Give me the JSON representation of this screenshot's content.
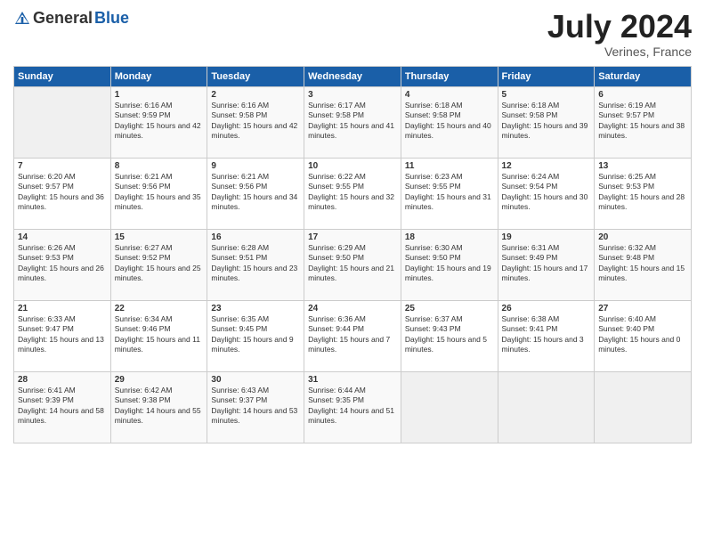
{
  "logo": {
    "general": "General",
    "blue": "Blue"
  },
  "title": "July 2024",
  "location": "Verines, France",
  "days": [
    "Sunday",
    "Monday",
    "Tuesday",
    "Wednesday",
    "Thursday",
    "Friday",
    "Saturday"
  ],
  "weeks": [
    [
      {
        "day": "",
        "empty": true
      },
      {
        "day": "1",
        "sunrise": "Sunrise: 6:16 AM",
        "sunset": "Sunset: 9:59 PM",
        "daylight": "Daylight: 15 hours and 42 minutes."
      },
      {
        "day": "2",
        "sunrise": "Sunrise: 6:16 AM",
        "sunset": "Sunset: 9:58 PM",
        "daylight": "Daylight: 15 hours and 42 minutes."
      },
      {
        "day": "3",
        "sunrise": "Sunrise: 6:17 AM",
        "sunset": "Sunset: 9:58 PM",
        "daylight": "Daylight: 15 hours and 41 minutes."
      },
      {
        "day": "4",
        "sunrise": "Sunrise: 6:18 AM",
        "sunset": "Sunset: 9:58 PM",
        "daylight": "Daylight: 15 hours and 40 minutes."
      },
      {
        "day": "5",
        "sunrise": "Sunrise: 6:18 AM",
        "sunset": "Sunset: 9:58 PM",
        "daylight": "Daylight: 15 hours and 39 minutes."
      },
      {
        "day": "6",
        "sunrise": "Sunrise: 6:19 AM",
        "sunset": "Sunset: 9:57 PM",
        "daylight": "Daylight: 15 hours and 38 minutes."
      }
    ],
    [
      {
        "day": "7",
        "sunrise": "Sunrise: 6:20 AM",
        "sunset": "Sunset: 9:57 PM",
        "daylight": "Daylight: 15 hours and 36 minutes."
      },
      {
        "day": "8",
        "sunrise": "Sunrise: 6:21 AM",
        "sunset": "Sunset: 9:56 PM",
        "daylight": "Daylight: 15 hours and 35 minutes."
      },
      {
        "day": "9",
        "sunrise": "Sunrise: 6:21 AM",
        "sunset": "Sunset: 9:56 PM",
        "daylight": "Daylight: 15 hours and 34 minutes."
      },
      {
        "day": "10",
        "sunrise": "Sunrise: 6:22 AM",
        "sunset": "Sunset: 9:55 PM",
        "daylight": "Daylight: 15 hours and 32 minutes."
      },
      {
        "day": "11",
        "sunrise": "Sunrise: 6:23 AM",
        "sunset": "Sunset: 9:55 PM",
        "daylight": "Daylight: 15 hours and 31 minutes."
      },
      {
        "day": "12",
        "sunrise": "Sunrise: 6:24 AM",
        "sunset": "Sunset: 9:54 PM",
        "daylight": "Daylight: 15 hours and 30 minutes."
      },
      {
        "day": "13",
        "sunrise": "Sunrise: 6:25 AM",
        "sunset": "Sunset: 9:53 PM",
        "daylight": "Daylight: 15 hours and 28 minutes."
      }
    ],
    [
      {
        "day": "14",
        "sunrise": "Sunrise: 6:26 AM",
        "sunset": "Sunset: 9:53 PM",
        "daylight": "Daylight: 15 hours and 26 minutes."
      },
      {
        "day": "15",
        "sunrise": "Sunrise: 6:27 AM",
        "sunset": "Sunset: 9:52 PM",
        "daylight": "Daylight: 15 hours and 25 minutes."
      },
      {
        "day": "16",
        "sunrise": "Sunrise: 6:28 AM",
        "sunset": "Sunset: 9:51 PM",
        "daylight": "Daylight: 15 hours and 23 minutes."
      },
      {
        "day": "17",
        "sunrise": "Sunrise: 6:29 AM",
        "sunset": "Sunset: 9:50 PM",
        "daylight": "Daylight: 15 hours and 21 minutes."
      },
      {
        "day": "18",
        "sunrise": "Sunrise: 6:30 AM",
        "sunset": "Sunset: 9:50 PM",
        "daylight": "Daylight: 15 hours and 19 minutes."
      },
      {
        "day": "19",
        "sunrise": "Sunrise: 6:31 AM",
        "sunset": "Sunset: 9:49 PM",
        "daylight": "Daylight: 15 hours and 17 minutes."
      },
      {
        "day": "20",
        "sunrise": "Sunrise: 6:32 AM",
        "sunset": "Sunset: 9:48 PM",
        "daylight": "Daylight: 15 hours and 15 minutes."
      }
    ],
    [
      {
        "day": "21",
        "sunrise": "Sunrise: 6:33 AM",
        "sunset": "Sunset: 9:47 PM",
        "daylight": "Daylight: 15 hours and 13 minutes."
      },
      {
        "day": "22",
        "sunrise": "Sunrise: 6:34 AM",
        "sunset": "Sunset: 9:46 PM",
        "daylight": "Daylight: 15 hours and 11 minutes."
      },
      {
        "day": "23",
        "sunrise": "Sunrise: 6:35 AM",
        "sunset": "Sunset: 9:45 PM",
        "daylight": "Daylight: 15 hours and 9 minutes."
      },
      {
        "day": "24",
        "sunrise": "Sunrise: 6:36 AM",
        "sunset": "Sunset: 9:44 PM",
        "daylight": "Daylight: 15 hours and 7 minutes."
      },
      {
        "day": "25",
        "sunrise": "Sunrise: 6:37 AM",
        "sunset": "Sunset: 9:43 PM",
        "daylight": "Daylight: 15 hours and 5 minutes."
      },
      {
        "day": "26",
        "sunrise": "Sunrise: 6:38 AM",
        "sunset": "Sunset: 9:41 PM",
        "daylight": "Daylight: 15 hours and 3 minutes."
      },
      {
        "day": "27",
        "sunrise": "Sunrise: 6:40 AM",
        "sunset": "Sunset: 9:40 PM",
        "daylight": "Daylight: 15 hours and 0 minutes."
      }
    ],
    [
      {
        "day": "28",
        "sunrise": "Sunrise: 6:41 AM",
        "sunset": "Sunset: 9:39 PM",
        "daylight": "Daylight: 14 hours and 58 minutes."
      },
      {
        "day": "29",
        "sunrise": "Sunrise: 6:42 AM",
        "sunset": "Sunset: 9:38 PM",
        "daylight": "Daylight: 14 hours and 55 minutes."
      },
      {
        "day": "30",
        "sunrise": "Sunrise: 6:43 AM",
        "sunset": "Sunset: 9:37 PM",
        "daylight": "Daylight: 14 hours and 53 minutes."
      },
      {
        "day": "31",
        "sunrise": "Sunrise: 6:44 AM",
        "sunset": "Sunset: 9:35 PM",
        "daylight": "Daylight: 14 hours and 51 minutes."
      },
      {
        "day": "",
        "empty": true
      },
      {
        "day": "",
        "empty": true
      },
      {
        "day": "",
        "empty": true
      }
    ]
  ]
}
